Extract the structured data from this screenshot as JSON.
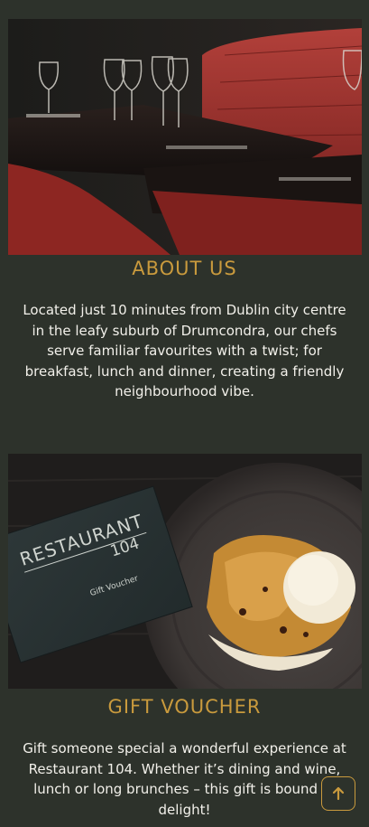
{
  "about": {
    "image_alt": "Restaurant interior with red leather booth seating and set tables",
    "heading": "ABOUT US",
    "text": "Located just 10 minutes from Dublin city centre in the leafy suburb of Drumcondra, our chefs serve familiar favourites with a twist; for breakfast, lunch and dinner, creating a friendly neighbourhood vibe."
  },
  "voucher": {
    "image_alt": "Restaurant 104 gift voucher card beside a dessert plate",
    "card_brand_line1": "RESTAURANT",
    "card_brand_line2": "104",
    "card_subtitle": "Gift Voucher",
    "heading": "GIFT VOUCHER",
    "text": "Gift someone special a wonderful experience at Restaurant 104. Whether it’s dining and wine, lunch or long brunches – this gift is bound to delight!"
  },
  "back_to_top": {
    "icon": "arrow-up-icon"
  },
  "colors": {
    "background": "#2d322b",
    "accent": "#c99a3d",
    "text": "#f2f0ea"
  }
}
